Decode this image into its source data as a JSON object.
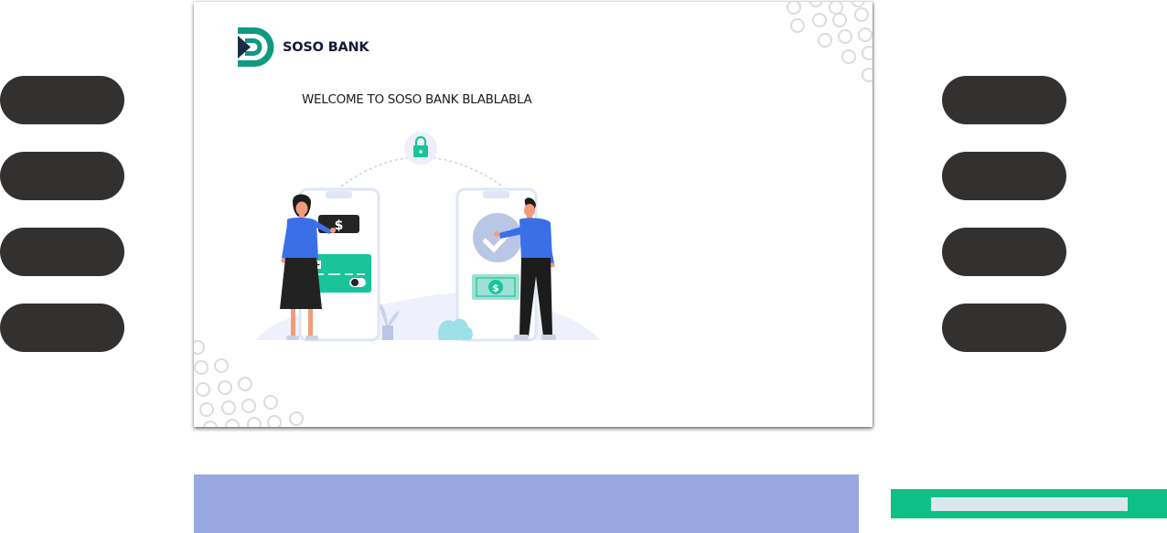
{
  "brand": {
    "name": "SOSO BANK",
    "logo_color": "#0e9a80",
    "logo_dark": "#1a2b4a"
  },
  "welcome_text": "WELCOME TO SOSO BANK BLABLABLA",
  "colors": {
    "side_button": "#333030",
    "address_bar": "#99a8e0",
    "action_button": "#0fbf88",
    "action_button_inner": "#dbe7ef"
  },
  "left_buttons": [
    "",
    "",
    "",
    ""
  ],
  "right_buttons": [
    "",
    "",
    "",
    ""
  ],
  "illustration": {
    "icons": [
      "lock-icon",
      "dollar-icon",
      "checkmark-icon"
    ]
  }
}
